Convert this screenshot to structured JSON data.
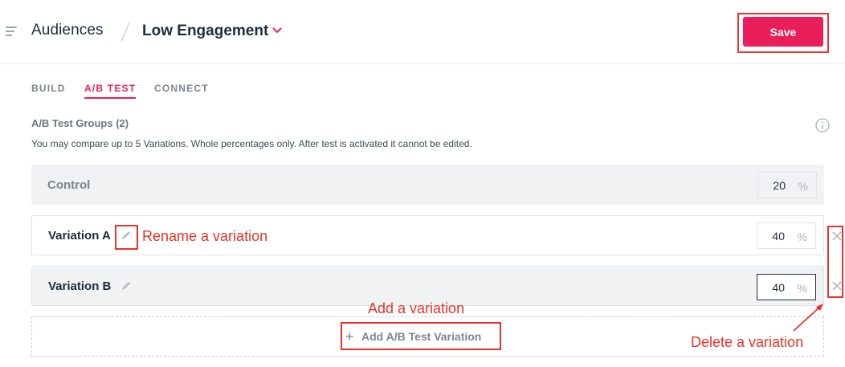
{
  "header": {
    "breadcrumb_root": "Audiences",
    "current_audience": "Low Engagement",
    "save_label": "Save"
  },
  "tabs": [
    {
      "label": "BUILD",
      "active": false
    },
    {
      "label": "A/B TEST",
      "active": true
    },
    {
      "label": "CONNECT",
      "active": false
    }
  ],
  "ab_test": {
    "title": "A/B Test Groups (2)",
    "description": "You may compare up to 5 Variations. Whole percentages only. After test is activated it cannot be edited.",
    "rows": [
      {
        "name": "Control",
        "percent": "20",
        "unit": "%"
      },
      {
        "name": "Variation A",
        "percent": "40",
        "unit": "%"
      },
      {
        "name": "Variation B",
        "percent": "40",
        "unit": "%"
      }
    ],
    "add_label": "Add A/B Test Variation",
    "add_icon": "+"
  },
  "annotations": {
    "rename": "Rename a variation",
    "add": "Add a variation",
    "delete": "Delete a variation"
  },
  "colors": {
    "accent": "#ea1e5a",
    "annotation": "#e8322a"
  },
  "icons": [
    "menu-icon",
    "chevron-down-icon",
    "info-icon",
    "pencil-icon",
    "close-icon",
    "plus-icon"
  ]
}
